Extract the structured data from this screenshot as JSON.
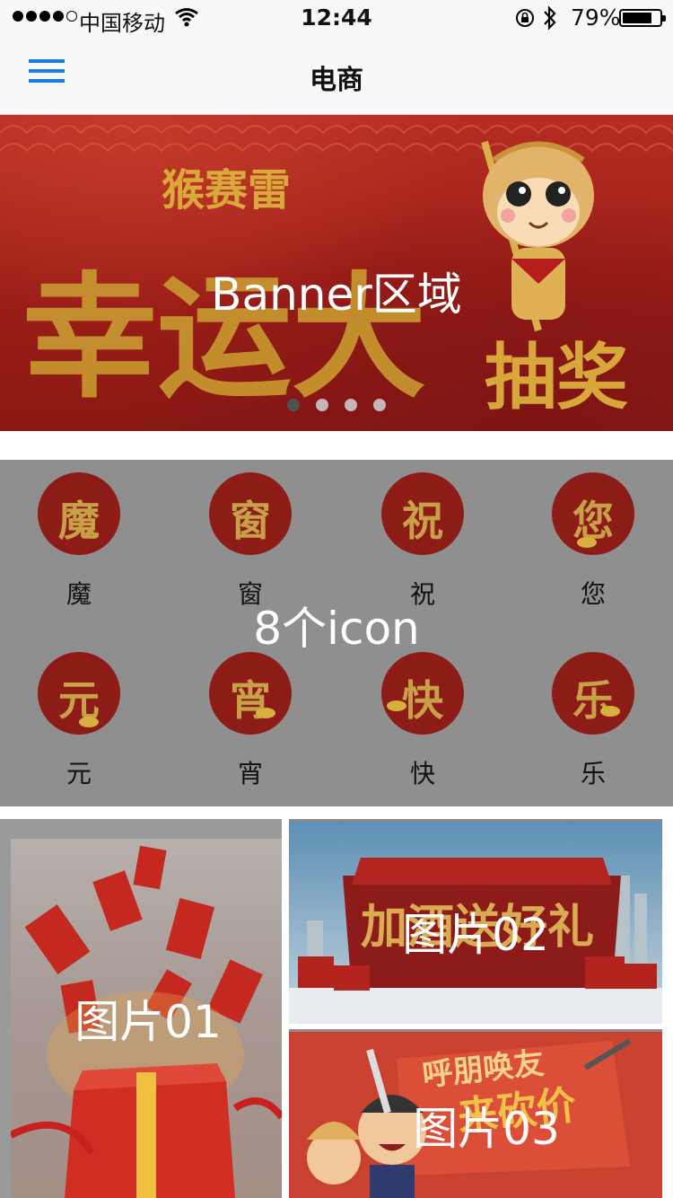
{
  "status_bar": {
    "carrier": "中国移动",
    "time": "12:44",
    "battery": "79%",
    "battery_level": 0.79,
    "signal_bars_filled": 4,
    "signal_bars_total": 5
  },
  "nav": {
    "title": "电商",
    "menu_icon": "hamburger-menu-icon",
    "accent_color": "#1a7de3"
  },
  "banner": {
    "label": "Banner区域",
    "art_text_top": "猴赛雷",
    "art_text_big": "幸运大",
    "art_text_right": "抽奖",
    "page_count": 4,
    "active_page": 1
  },
  "icon_grid": {
    "caption": "8个icon",
    "items": [
      {
        "label": "魔",
        "glyph": "魔"
      },
      {
        "label": "窗",
        "glyph": "窗"
      },
      {
        "label": "祝",
        "glyph": "祝"
      },
      {
        "label": "您",
        "glyph": "您"
      },
      {
        "label": "元",
        "glyph": "元"
      },
      {
        "label": "宵",
        "glyph": "宵"
      },
      {
        "label": "快",
        "glyph": "快"
      },
      {
        "label": "乐",
        "glyph": "乐"
      }
    ]
  },
  "pictures": {
    "pic01": {
      "label": "图片01"
    },
    "pic02": {
      "label": "图片02",
      "art_text": "加酒送好礼"
    },
    "pic03": {
      "label": "图片03",
      "art_text_1": "呼朋唤友",
      "art_text_2": "来砍价"
    }
  },
  "colors": {
    "banner_red": "#9c1e18",
    "gold": "#c8a048",
    "grid_gray": "#8f8f8f"
  }
}
